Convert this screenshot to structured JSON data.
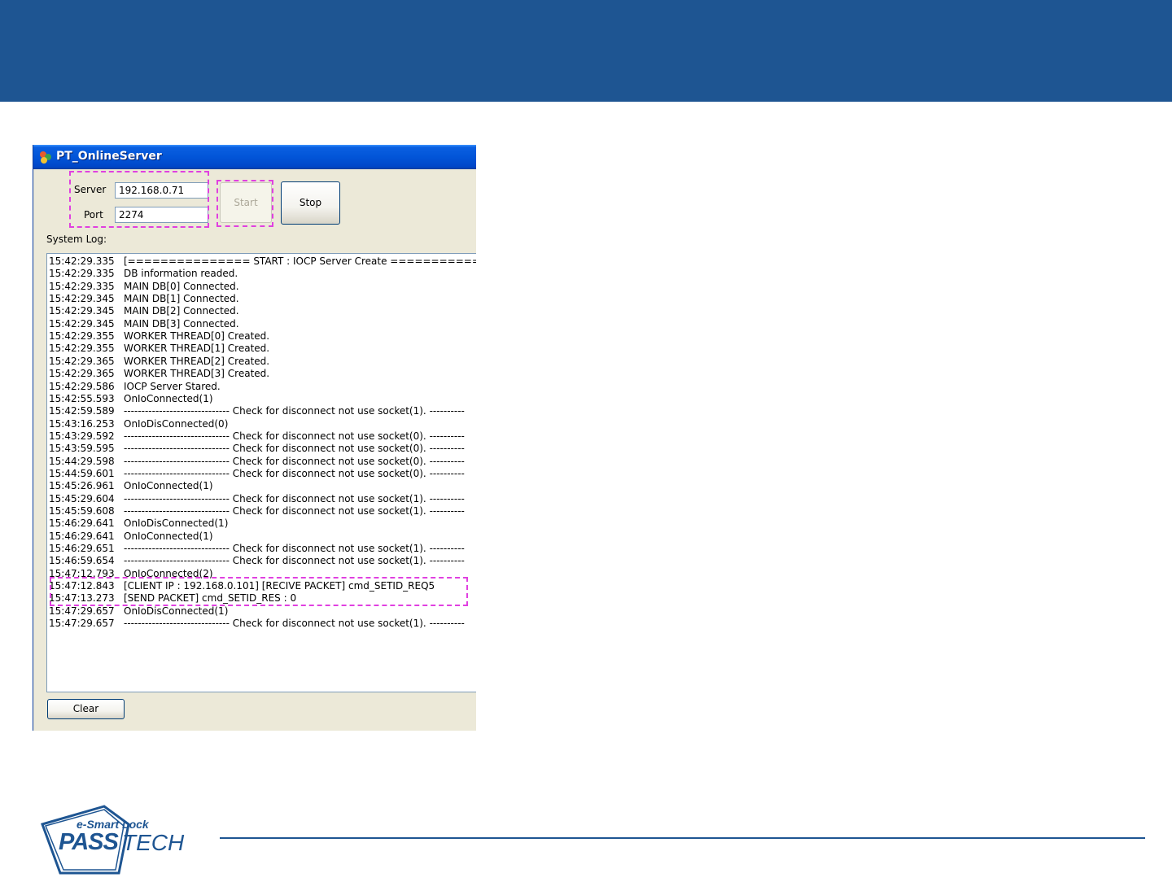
{
  "window": {
    "title": "PT_OnlineServer"
  },
  "connection": {
    "server_label": "Server",
    "server_value": "192.168.0.71",
    "port_label": "Port",
    "port_value": "2274"
  },
  "buttons": {
    "start": "Start",
    "stop": "Stop",
    "clear": "Clear"
  },
  "system_log": {
    "label": "System Log:",
    "entries": [
      {
        "time": "15:42:29.335",
        "msg": "[=============== START : IOCP Server Create ==========="
      },
      {
        "time": "15:42:29.335",
        "msg": "DB information readed."
      },
      {
        "time": "15:42:29.335",
        "msg": "MAIN DB[0] Connected."
      },
      {
        "time": "15:42:29.345",
        "msg": "MAIN DB[1] Connected."
      },
      {
        "time": "15:42:29.345",
        "msg": "MAIN DB[2] Connected."
      },
      {
        "time": "15:42:29.345",
        "msg": "MAIN DB[3] Connected."
      },
      {
        "time": "15:42:29.355",
        "msg": "WORKER THREAD[0] Created."
      },
      {
        "time": "15:42:29.355",
        "msg": "WORKER THREAD[1] Created."
      },
      {
        "time": "15:42:29.365",
        "msg": "WORKER THREAD[2] Created."
      },
      {
        "time": "15:42:29.365",
        "msg": "WORKER THREAD[3] Created."
      },
      {
        "time": "15:42:29.586",
        "msg": "IOCP Server Stared."
      },
      {
        "time": "15:42:55.593",
        "msg": "OnIoConnected(1)"
      },
      {
        "time": "15:42:59.589",
        "msg": "------------------------------ Check for disconnect not use socket(1). ----------"
      },
      {
        "time": "15:43:16.253",
        "msg": "OnIoDisConnected(0)"
      },
      {
        "time": "15:43:29.592",
        "msg": "------------------------------ Check for disconnect not use socket(0). ----------"
      },
      {
        "time": "15:43:59.595",
        "msg": "------------------------------ Check for disconnect not use socket(0). ----------"
      },
      {
        "time": "15:44:29.598",
        "msg": "------------------------------ Check for disconnect not use socket(0). ----------"
      },
      {
        "time": "15:44:59.601",
        "msg": "------------------------------ Check for disconnect not use socket(0). ----------"
      },
      {
        "time": "15:45:26.961",
        "msg": "OnIoConnected(1)"
      },
      {
        "time": "15:45:29.604",
        "msg": "------------------------------ Check for disconnect not use socket(1). ----------"
      },
      {
        "time": "15:45:59.608",
        "msg": "------------------------------ Check for disconnect not use socket(1). ----------"
      },
      {
        "time": "15:46:29.641",
        "msg": "OnIoDisConnected(1)"
      },
      {
        "time": "15:46:29.641",
        "msg": "OnIoConnected(1)"
      },
      {
        "time": "15:46:29.651",
        "msg": "------------------------------ Check for disconnect not use socket(1). ----------"
      },
      {
        "time": "15:46:59.654",
        "msg": "------------------------------ Check for disconnect not use socket(1). ----------"
      },
      {
        "time": "15:47:12.793",
        "msg": "OnIoConnected(2)"
      },
      {
        "time": "15:47:12.843",
        "msg": "[CLIENT IP : 192.168.0.101] [RECIVE PACKET] cmd_SETID_REQ5"
      },
      {
        "time": "15:47:13.273",
        "msg": "[SEND PACKET] cmd_SETID_RES : 0"
      },
      {
        "time": "15:47:29.657",
        "msg": "OnIoDisConnected(1)"
      },
      {
        "time": "15:47:29.657",
        "msg": "------------------------------ Check for disconnect not use socket(1). ----------"
      }
    ]
  },
  "logo": {
    "tagline": "e-Smart Lock",
    "brand_bold": "PASS",
    "brand_light": "TECH"
  },
  "colors": {
    "header_band": "#1e5592",
    "highlight_dash": "#e040e0",
    "logo_blue": "#1e5592"
  }
}
